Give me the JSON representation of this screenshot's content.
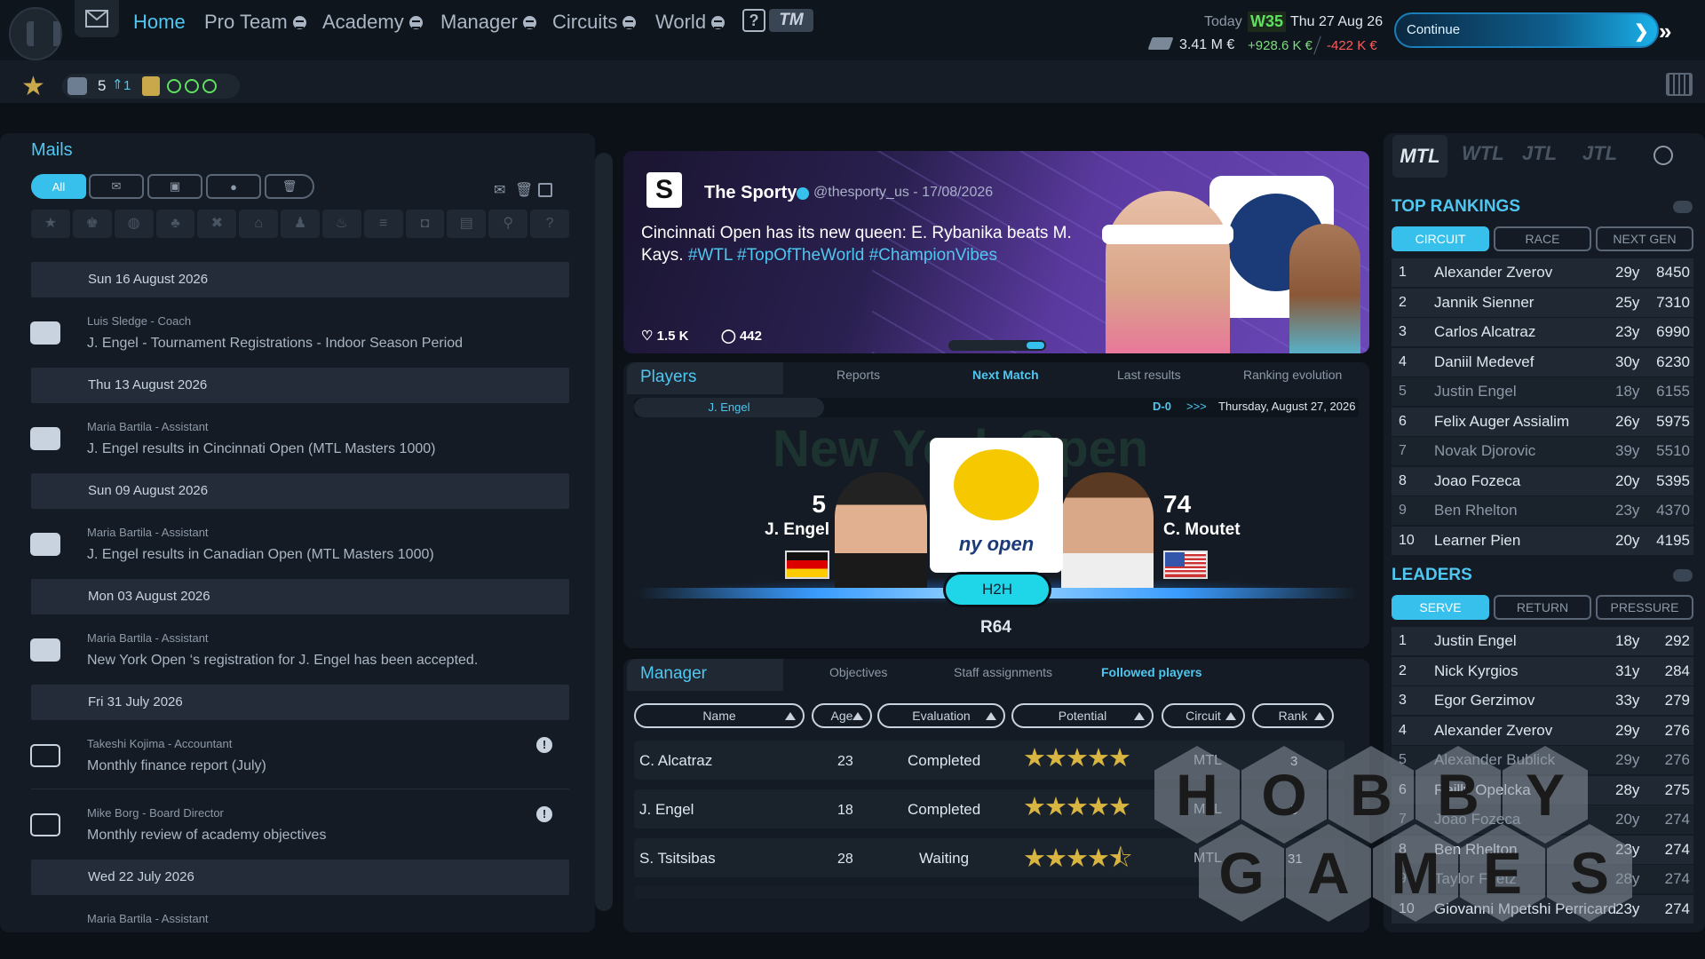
{
  "nav": {
    "home": "Home",
    "pro_team": "Pro Team",
    "academy": "Academy",
    "manager": "Manager",
    "circuits": "Circuits",
    "world": "World",
    "help": "?",
    "tm": "TM"
  },
  "status": {
    "today_label": "Today",
    "week": "W35",
    "date": "Thu 27 Aug 26",
    "money": "3.41 M €",
    "income": "+928.6 K €",
    "expense": "-422 K €",
    "continue": "Continue",
    "count": "5",
    "delta": "1"
  },
  "mails": {
    "title": "Mails",
    "filter_all": "All",
    "days": [
      "Sun 16 August 2026",
      "Thu 13 August 2026",
      "Sun 09 August 2026",
      "Mon 03 August 2026",
      "Fri 31 July 2026",
      "Wed 22 July 2026"
    ],
    "items": [
      {
        "from": "Luis Sledge - Coach",
        "subject": "J. Engel - Tournament Registrations - Indoor Season Period"
      },
      {
        "from": "Maria Bartila - Assistant",
        "subject": "J. Engel results in Cincinnati Open (MTL Masters 1000)"
      },
      {
        "from": "Maria Bartila - Assistant",
        "subject": "J. Engel results in Canadian Open (MTL Masters 1000)"
      },
      {
        "from": "Maria Bartila - Assistant",
        "subject": "New York Open ‘s registration for J. Engel has been accepted."
      },
      {
        "from": "Takeshi Kojima - Accountant",
        "subject": "Monthly finance report (July)"
      },
      {
        "from": "Mike Borg - Board Director",
        "subject": "Monthly review of academy objectives"
      },
      {
        "from": "Maria Bartila - Assistant",
        "subject": ""
      }
    ],
    "warn": "!",
    "cat_q": "?"
  },
  "news": {
    "logo": "S",
    "name": "The Sporty",
    "handle": "@thesporty_us - 17/08/2026",
    "text_a": "Cincinnati Open has its new queen: E. Rybanika beats M. Kays. ",
    "tags": "#WTL #TopOfTheWorld #ChampionVibes",
    "likes": "♡ 1.5 K",
    "comments": "◯ 442"
  },
  "players": {
    "title": "Players",
    "tabs": [
      "Reports",
      "Next Match",
      "Last results",
      "Ranking evolution"
    ],
    "selected": "J. Engel",
    "d0": "D-0",
    "arrows": ">>>",
    "date": "Thursday, August 27, 2026",
    "bg_title": "New York Open",
    "p1": {
      "rank": "5",
      "name": "J. Engel"
    },
    "p2": {
      "rank": "74",
      "name": "C. Moutet"
    },
    "logo_text": "ny open",
    "h2h": "H2H",
    "round": "R64"
  },
  "manager": {
    "title": "Manager",
    "tabs": [
      "Objectives",
      "Staff assignments",
      "Followed players"
    ],
    "cols": [
      "Name",
      "Age",
      "Evaluation",
      "Potential",
      "Circuit",
      "Rank"
    ],
    "rows": [
      {
        "name": "C. Alcatraz",
        "age": "23",
        "eval": "Completed",
        "stars": "★★★★★",
        "potential": 5,
        "circuit": "MTL",
        "rank": "3"
      },
      {
        "name": "J. Engel",
        "age": "18",
        "eval": "Completed",
        "stars": "★★★★★",
        "potential": 5,
        "circuit": "MTL",
        "rank": "5"
      },
      {
        "name": "S. Tsitsibas",
        "age": "28",
        "eval": "Waiting",
        "stars": "★★★★⯪",
        "potential": 4.5,
        "circuit": "MTL",
        "rank": "31"
      }
    ]
  },
  "right": {
    "tours": [
      "MTL",
      "WTL",
      "JTL",
      "JTL"
    ],
    "top_title": "TOP RANKINGS",
    "top_tabs": [
      "CIRCUIT",
      "RACE",
      "NEXT GEN"
    ],
    "top": [
      {
        "n": "1",
        "name": "Alexander Zverov",
        "age": "29y",
        "pts": "8450"
      },
      {
        "n": "2",
        "name": "Jannik Sienner",
        "age": "25y",
        "pts": "7310"
      },
      {
        "n": "3",
        "name": "Carlos Alcatraz",
        "age": "23y",
        "pts": "6990"
      },
      {
        "n": "4",
        "name": "Daniil Medevef",
        "age": "30y",
        "pts": "6230"
      },
      {
        "n": "5",
        "name": "Justin Engel",
        "age": "18y",
        "pts": "6155"
      },
      {
        "n": "6",
        "name": "Felix Auger Assialim",
        "age": "26y",
        "pts": "5975"
      },
      {
        "n": "7",
        "name": "Novak Djorovic",
        "age": "39y",
        "pts": "5510"
      },
      {
        "n": "8",
        "name": "Joao Fozeca",
        "age": "20y",
        "pts": "5395"
      },
      {
        "n": "9",
        "name": "Ben Rhelton",
        "age": "23y",
        "pts": "4370"
      },
      {
        "n": "10",
        "name": "Learner Pien",
        "age": "20y",
        "pts": "4195"
      }
    ],
    "lead_title": "LEADERS",
    "lead_tabs": [
      "SERVE",
      "RETURN",
      "PRESSURE"
    ],
    "leaders": [
      {
        "n": "1",
        "name": "Justin Engel",
        "age": "18y",
        "pts": "292"
      },
      {
        "n": "2",
        "name": "Nick Kyrgios",
        "age": "31y",
        "pts": "284"
      },
      {
        "n": "3",
        "name": "Egor Gerzimov",
        "age": "33y",
        "pts": "279"
      },
      {
        "n": "4",
        "name": "Alexander Zverov",
        "age": "29y",
        "pts": "276"
      },
      {
        "n": "5",
        "name": "Alexander Bublick",
        "age": "29y",
        "pts": "276"
      },
      {
        "n": "6",
        "name": "Reilly Opelcka",
        "age": "28y",
        "pts": "275"
      },
      {
        "n": "7",
        "name": "Joao Fozeca",
        "age": "20y",
        "pts": "274"
      },
      {
        "n": "8",
        "name": "Ben Rhelton",
        "age": "23y",
        "pts": "274"
      },
      {
        "n": "9",
        "name": "Taylor Frietz",
        "age": "28y",
        "pts": "274"
      },
      {
        "n": "10",
        "name": "Giovanni Mpetshi Perricard",
        "age": "23y",
        "pts": "274"
      }
    ]
  },
  "watermark": {
    "letters": [
      "H",
      "O",
      "B",
      "B",
      "Y",
      "G",
      "A",
      "M",
      "E",
      "S"
    ]
  },
  "colors": {
    "accent": "#38c0ec",
    "gold": "#d8b440",
    "green": "#7fdc7f",
    "red": "#ff5a5a"
  }
}
